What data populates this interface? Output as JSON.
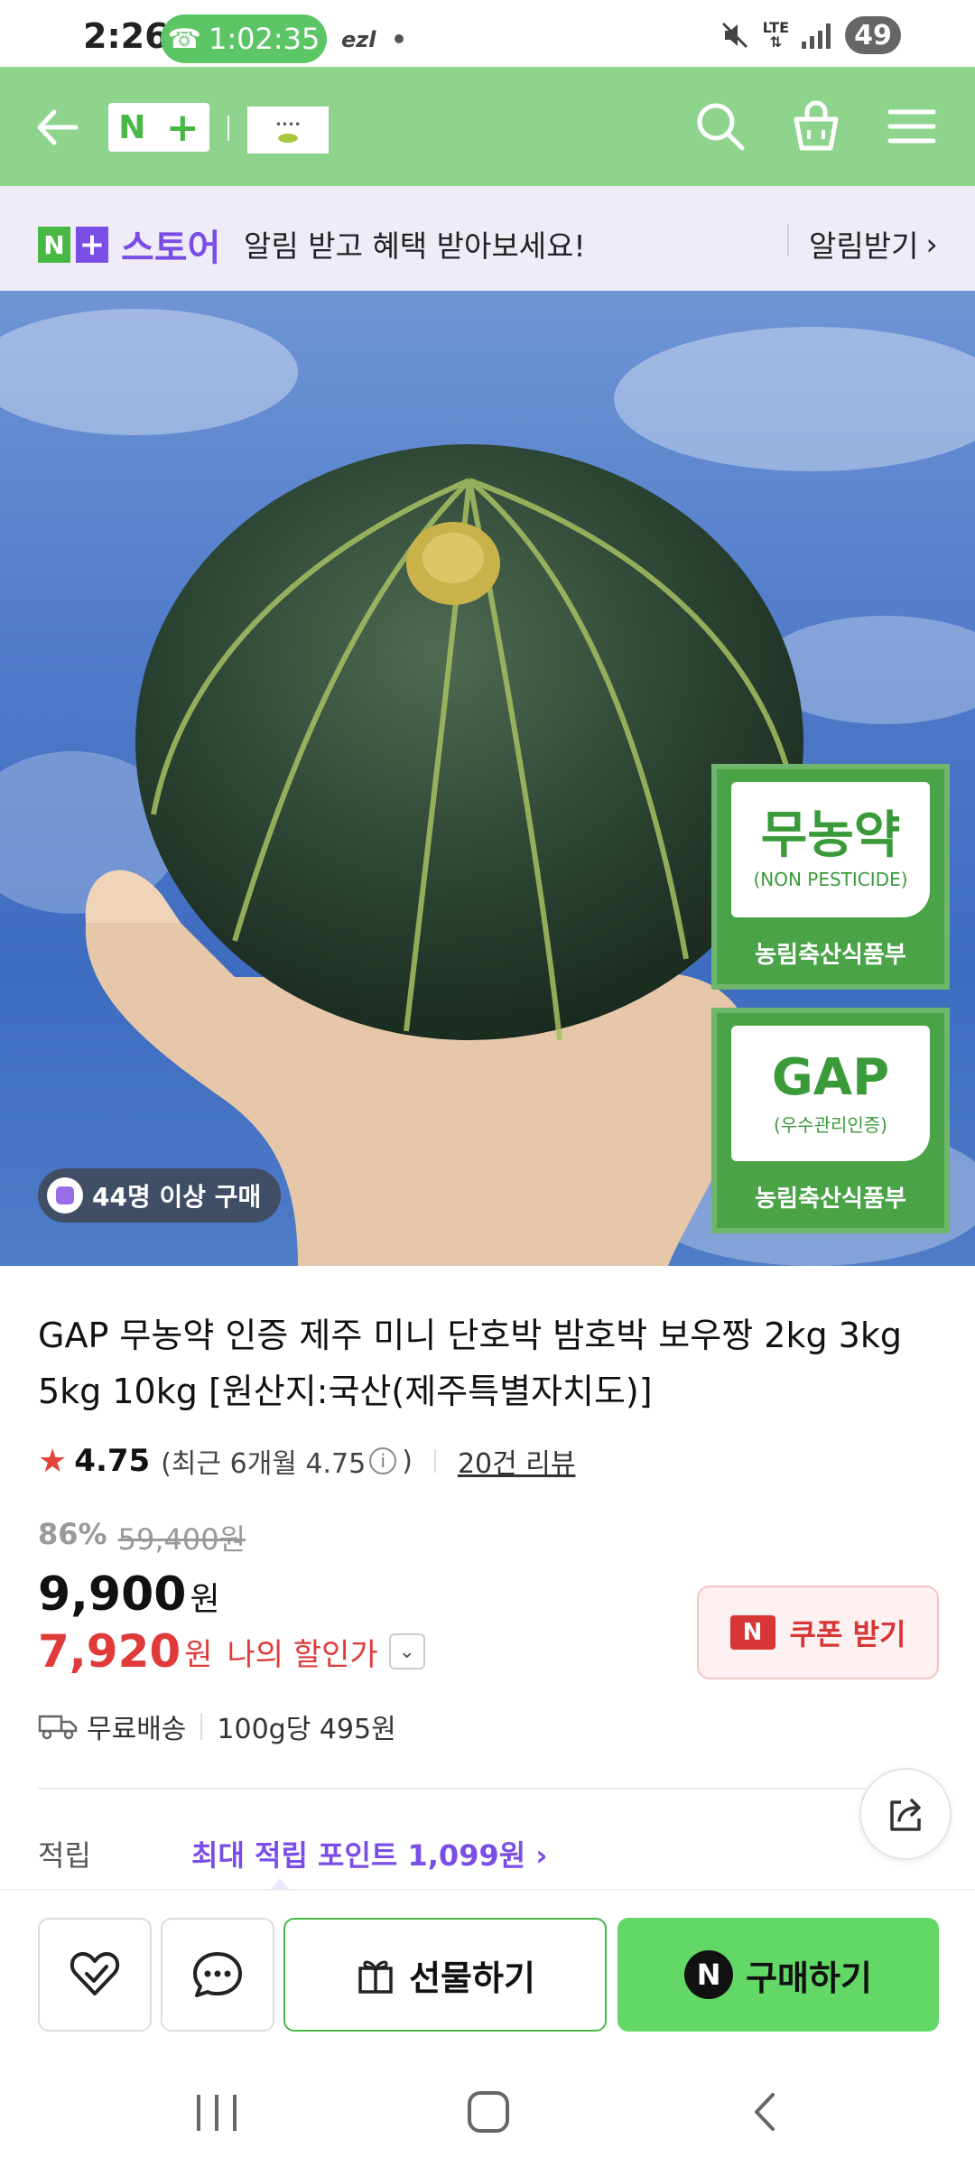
{
  "status_bar": {
    "time": "2:26",
    "call_timer": "1:02:35",
    "carrier": "ezl",
    "network": "LTE",
    "battery": "49"
  },
  "header": {
    "logo_text_n": "N",
    "logo_text_plus": "+"
  },
  "banner": {
    "store_n": "N",
    "store_plus": "+",
    "store_label": "스토어",
    "message": "알림 받고 혜택 받아보세요!",
    "button_label": "알림받기",
    "button_chevron": "›"
  },
  "hero": {
    "badges": [
      {
        "title": "무농약",
        "subtitle": "(NON PESTICIDE)",
        "footer": "농림축산식품부"
      },
      {
        "title": "GAP",
        "subtitle": "(우수관리인증)",
        "footer": "농림축산식품부"
      }
    ],
    "buyer_chip": "44명 이상 구매"
  },
  "product": {
    "title": "GAP 무농약 인증 제주 미니 단호박 밤호박 보우짱 2kg 3kg 5kg 10kg [원산지:국산(제주특별자치도)]",
    "rating": "4.75",
    "recent_rating_prefix": "(최근 6개월 4.75",
    "recent_rating_suffix": ")",
    "review_count": "20건 리뷰",
    "discount_rate": "86%",
    "original_price": "59,400원",
    "price": "9,900",
    "price_unit": "원",
    "my_price": "7,920",
    "my_price_unit": "원",
    "my_price_label": "나의 할인가",
    "coupon_label": "쿠폰 받기",
    "coupon_n": "N",
    "shipping": "무료배송",
    "unit_price": "100g당 495원",
    "points_label": "적립",
    "points_value": "최대 적립 포인트 1,099원 ›"
  },
  "actions": {
    "gift_label": "선물하기",
    "buy_label": "구매하기",
    "buy_n": "N"
  },
  "colors": {
    "header_green": "#8ed48c",
    "brand_purple": "#7a4ee6",
    "buy_green": "#63d867",
    "price_red": "#e03a3a"
  }
}
